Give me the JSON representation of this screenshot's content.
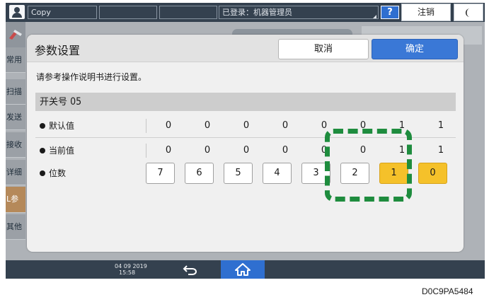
{
  "topbar": {
    "app_label": "Copy",
    "login_status": "已登录：机器管理员",
    "help_label": "?",
    "logout_label": "注销"
  },
  "sidebar": {
    "items": [
      {
        "label": "常用"
      },
      {
        "label": "扫描"
      },
      {
        "label": "发送"
      },
      {
        "label": "接收"
      },
      {
        "label": "详细"
      },
      {
        "label": "L参"
      },
      {
        "label": "其他"
      }
    ]
  },
  "dialog": {
    "title": "参数设置",
    "cancel_label": "取消",
    "ok_label": "确定",
    "message": "请参考操作说明书进行设置。",
    "switch_label": "开关号",
    "switch_number": "05",
    "rows": {
      "default": {
        "label": "默认值",
        "values": [
          "0",
          "0",
          "0",
          "0",
          "0",
          "0",
          "1",
          "1"
        ]
      },
      "current": {
        "label": "当前值",
        "values": [
          "0",
          "0",
          "0",
          "0",
          "0",
          "0",
          "1",
          "1"
        ]
      },
      "bits": {
        "label": "位数",
        "values": [
          "7",
          "6",
          "5",
          "4",
          "3",
          "2",
          "1",
          "0"
        ],
        "on": [
          false,
          false,
          false,
          false,
          false,
          false,
          true,
          true
        ]
      }
    }
  },
  "bottombar": {
    "date": "04 09 2019",
    "time": "15:58"
  },
  "figure_code": "D0C9PA5484",
  "colors": {
    "dark_bar": "#34414f",
    "primary": "#3a78d6",
    "bit_on": "#f5c12a",
    "highlight": "#1e8c3e"
  }
}
